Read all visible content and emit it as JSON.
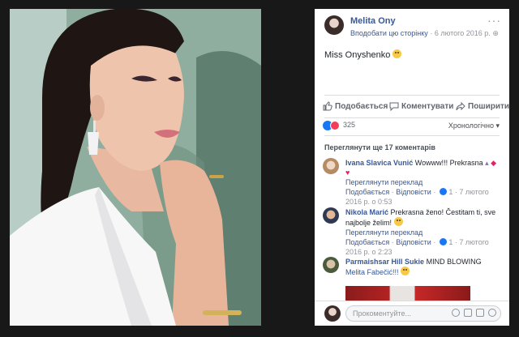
{
  "post": {
    "page_name": "Melita Ony",
    "like_page": "Вподобати цю сторінку",
    "separator": "·",
    "date": "6 лютого 2016 р.",
    "caption": "Miss Onyshenko"
  },
  "actions": {
    "like": "Подобається",
    "comment": "Коментувати",
    "share": "Поширити"
  },
  "reactions": {
    "count": "325"
  },
  "sort_label": "Хронологічно ▾",
  "more_comments": "Переглянути ще 17 коментарів",
  "comments": [
    {
      "name": "Ivana Slavica Vunić",
      "text": "Wowww!!! Prekrasna",
      "translate": "Переглянути переклад",
      "like": "Подобається",
      "reply": "Відповісти",
      "likes": "1",
      "time": "7 лютого 2016 р. о 0:53"
    },
    {
      "name": "Nikola Marić",
      "text": "Prekrasna ženo! Čestitam ti, sve najbolje želim!",
      "translate": "Переглянути переклад",
      "like": "Подобається",
      "reply": "Відповісти",
      "likes": "1",
      "time": "7 лютого 2016 р. о 2:23"
    },
    {
      "name": "Parmaishsar Hill Sukie",
      "text": "MIND BLOWING",
      "mention": "Melita Fabečić!!!"
    }
  ],
  "composer": {
    "placeholder": "Прокоментуйте..."
  },
  "colors": {
    "link": "#385898",
    "like_blue": "#1877f2",
    "love_red": "#f33e58"
  }
}
